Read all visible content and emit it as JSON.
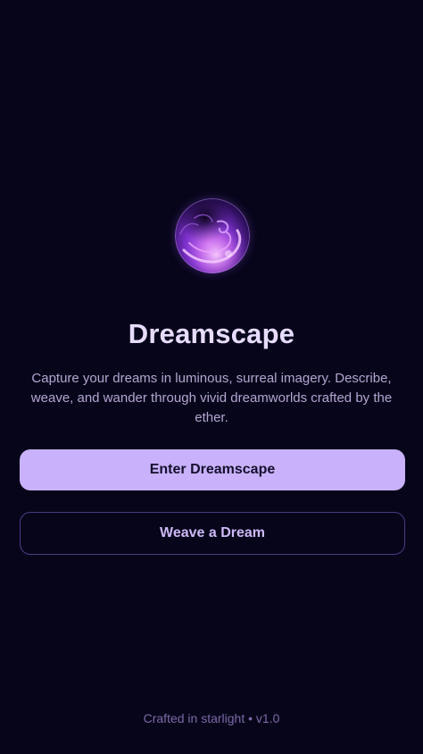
{
  "app": {
    "title": "Dreamscape",
    "tagline": "Capture your dreams in luminous, surreal imagery. Describe, weave, and wander through vivid dreamworlds crafted by the ether.",
    "logo_icon": "dream-orb-icon"
  },
  "actions": {
    "primary_label": "Enter Dreamscape",
    "secondary_label": "Weave a Dream"
  },
  "footer": {
    "text": "Crafted in starlight • v1.0"
  },
  "colors": {
    "background": "#07051a",
    "primary_button": "#c9b2fb",
    "title": "#e7dcff",
    "accent_border": "#4c3b85"
  }
}
